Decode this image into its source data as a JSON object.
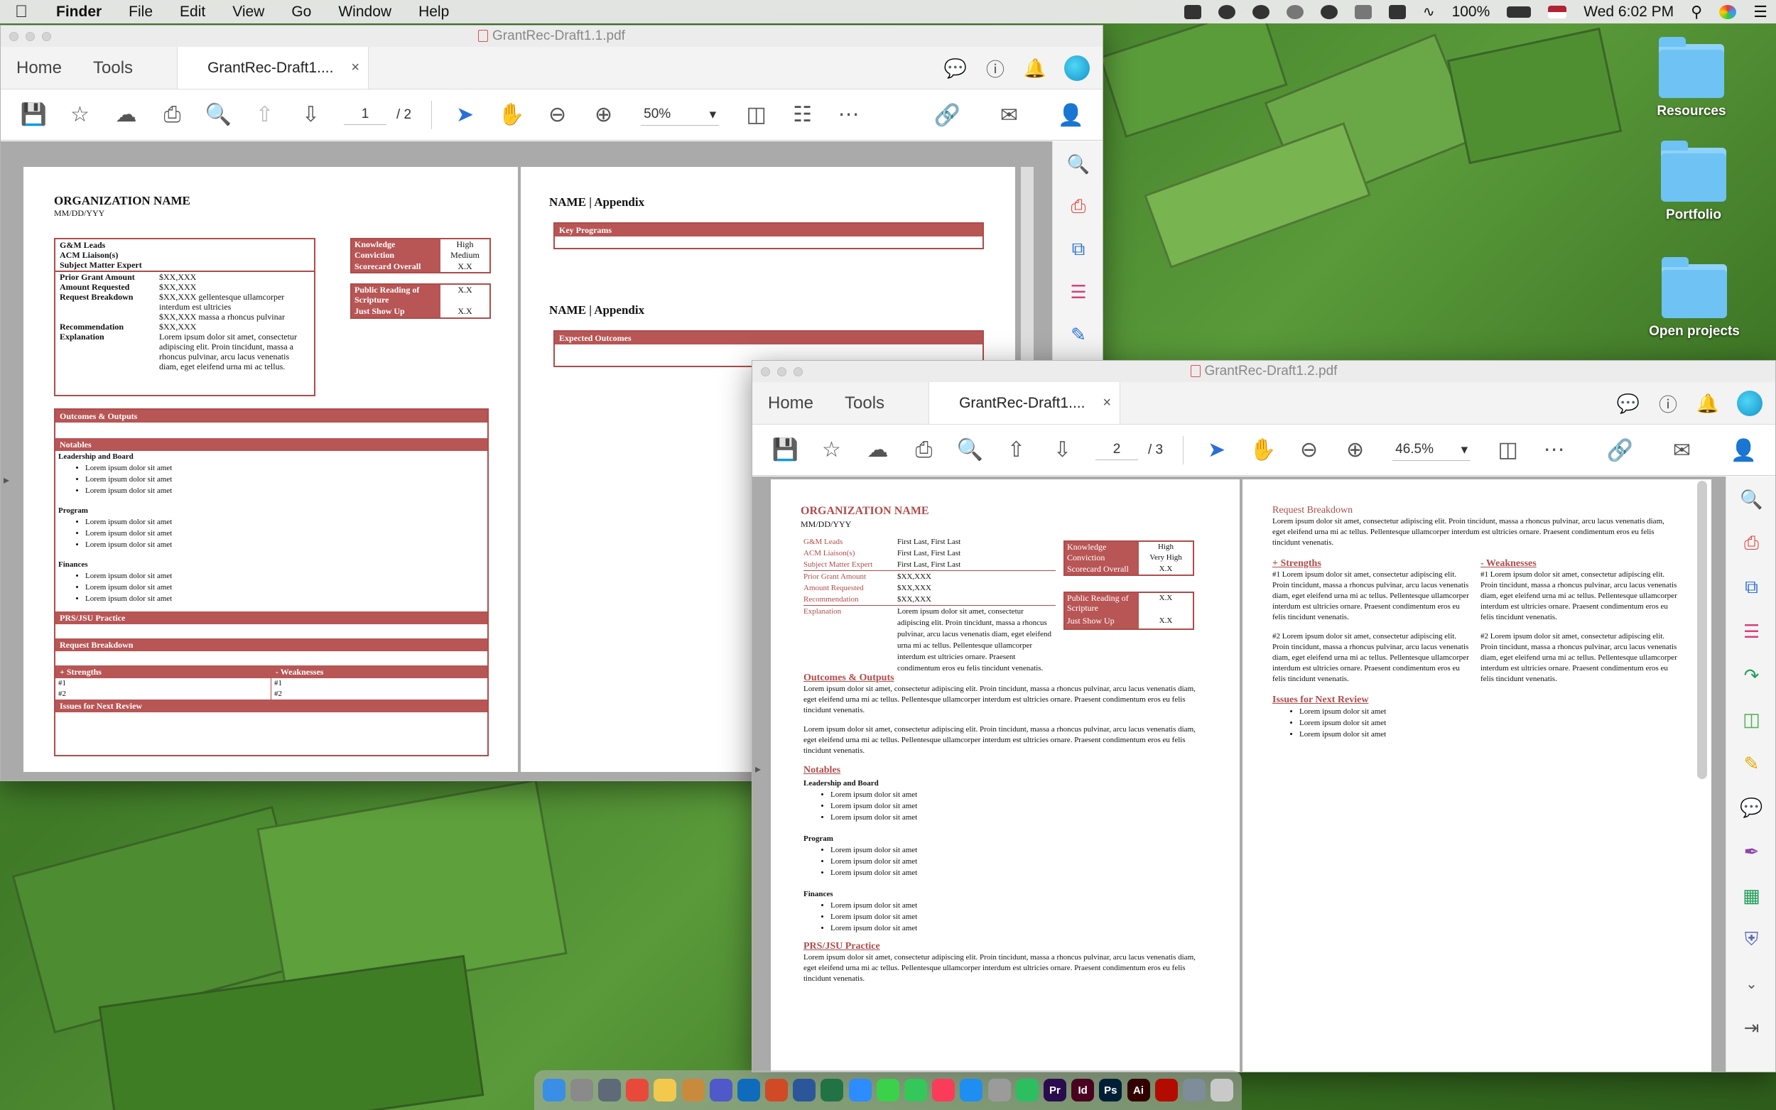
{
  "menubar": {
    "app": "Finder",
    "items": [
      "File",
      "Edit",
      "View",
      "Go",
      "Window",
      "Help"
    ],
    "battery": "100%",
    "clock": "Wed 6:02 PM"
  },
  "desktop": {
    "folders": [
      "Resources",
      "Portfolio",
      "Open projects"
    ]
  },
  "window1": {
    "title": "GrantRec-Draft1.1.pdf",
    "nav_home": "Home",
    "nav_tools": "Tools",
    "tab_label": "GrantRec-Draft1....",
    "tab_close": "×",
    "page_current": "1",
    "page_total": "/  2",
    "zoom": "50%",
    "page1": {
      "org_name": "ORGANIZATION NAME",
      "date": "MM/DD/YYY",
      "leads": [
        "G&M Leads",
        "ACM Liaison(s)",
        "Subject Matter Expert"
      ],
      "fields": [
        {
          "label": "Prior Grant Amount",
          "value": "$XX,XXX"
        },
        {
          "label": "Amount Requested",
          "value": "$XX,XXX"
        },
        {
          "label": "Request Breakdown",
          "value": "$XX,XXX gellentesque ullamcorper interdum est ultricies"
        },
        {
          "label": "",
          "value": "$XX,XXX massa a rhoncus pulvinar"
        },
        {
          "label": "Recommendation",
          "value": "$XX,XXX"
        },
        {
          "label": "Explanation",
          "value": "Lorem ipsum dolor sit amet, consectetur adipiscing elit. Proin tincidunt, massa a rhoncus pulvinar, arcu lacus venenatis diam, eget eleifend urna mi ac tellus."
        }
      ],
      "scorecard": [
        {
          "label": "Knowledge",
          "value": "High"
        },
        {
          "label": "Conviction",
          "value": "Medium"
        },
        {
          "label": "Scorecard Overall",
          "value": "X.X"
        }
      ],
      "reading": [
        {
          "label": "Public Reading of Scripture",
          "value": "X.X"
        },
        {
          "label": "Just Show Up",
          "value": "X.X"
        }
      ],
      "outcomes": "Outcomes & Outputs",
      "notables": "Notables",
      "groups": [
        {
          "title": "Leadership and Board",
          "items": [
            "Lorem ipsum dolor sit amet",
            "Lorem ipsum dolor sit amet",
            "Lorem ipsum dolor sit amet"
          ]
        },
        {
          "title": "Program",
          "items": [
            "Lorem ipsum dolor sit amet",
            "Lorem ipsum dolor sit amet",
            "Lorem ipsum dolor sit amet"
          ]
        },
        {
          "title": "Finances",
          "items": [
            "Lorem ipsum dolor sit amet",
            "Lorem ipsum dolor sit amet",
            "Lorem ipsum dolor sit amet"
          ]
        }
      ],
      "prs": "PRS/JSU Practice",
      "request_breakdown": "Request Breakdown",
      "strengths": "+ Strengths",
      "weaknesses": "- Weaknesses",
      "s1": "#1",
      "s2": "#2",
      "issues": "Issues for Next Review"
    },
    "page2": {
      "appendix1": "NAME | Appendix",
      "key_programs": "Key Programs",
      "appendix2": "NAME | Appendix",
      "expected_outcomes": "Expected Outcomes"
    }
  },
  "window2": {
    "title": "GrantRec-Draft1.2.pdf",
    "nav_home": "Home",
    "nav_tools": "Tools",
    "tab_label": "GrantRec-Draft1....",
    "tab_close": "×",
    "page_current": "2",
    "page_total": "/  3",
    "zoom": "46.5%",
    "left": {
      "org_name": "ORGANIZATION NAME",
      "date": "MM/DD/YYY",
      "fields": [
        {
          "label": "G&M Leads",
          "value": "First Last, First Last"
        },
        {
          "label": "ACM Liaison(s)",
          "value": "First Last, First Last"
        },
        {
          "label": "Subject Matter Expert",
          "value": "First Last, First Last"
        },
        {
          "label": "Prior Grant Amount",
          "value": "$XX,XXX"
        },
        {
          "label": "Amount Requested",
          "value": "$XX,XXX"
        },
        {
          "label": "Recommendation",
          "value": "$XX,XXX"
        },
        {
          "label": "Explanation",
          "value": "Lorem ipsum dolor sit amet, consectetur adipiscing elit. Proin tincidunt, massa a rhoncus pulvinar, arcu lacus venenatis diam, eget eleifend urna mi ac tellus. Pellentesque ullamcorper interdum est ultricies ornare. Praesent condimentum eros eu felis tincidunt venenatis."
        }
      ],
      "scorecard": [
        {
          "label": "Knowledge",
          "value": "High"
        },
        {
          "label": "Conviction",
          "value": "Very High"
        },
        {
          "label": "Scorecard Overall",
          "value": "X.X"
        }
      ],
      "reading": [
        {
          "label": "Public Reading of Scripture",
          "value": "X.X"
        },
        {
          "label": "Just Show Up",
          "value": "X.X"
        }
      ],
      "outcomes_title": "Outcomes & Outputs",
      "outcomes_p1": "Lorem ipsum dolor sit amet, consectetur adipiscing elit. Proin tincidunt, massa a rhoncus pulvinar, arcu lacus venenatis diam, eget eleifend urna mi ac tellus. Pellentesque ullamcorper interdum est ultricies ornare. Praesent condimentum eros eu felis tincidunt venenatis.",
      "outcomes_p2": "Lorem ipsum dolor sit amet, consectetur adipiscing elit. Proin tincidunt, massa a rhoncus pulvinar, arcu lacus venenatis diam, eget eleifend urna mi ac tellus. Pellentesque ullamcorper interdum est ultricies ornare. Praesent condimentum eros eu felis tincidunt venenatis.",
      "notables_title": "Notables",
      "groups": [
        {
          "title": "Leadership and Board",
          "items": [
            "Lorem ipsum dolor sit amet",
            "Lorem ipsum dolor sit amet",
            "Lorem ipsum dolor sit amet"
          ]
        },
        {
          "title": "Program",
          "items": [
            "Lorem ipsum dolor sit amet",
            "Lorem ipsum dolor sit amet",
            "Lorem ipsum dolor sit amet"
          ]
        },
        {
          "title": "Finances",
          "items": [
            "Lorem ipsum dolor sit amet",
            "Lorem ipsum dolor sit amet",
            "Lorem ipsum dolor sit amet"
          ]
        }
      ],
      "prs_title": "PRS/JSU Practice",
      "prs_text": "Lorem ipsum dolor sit amet, consectetur adipiscing elit. Proin tincidunt, massa a rhoncus pulvinar, arcu lacus venenatis diam, eget eleifend urna mi ac tellus. Pellentesque ullamcorper interdum est ultricies ornare. Praesent condimentum eros eu felis tincidunt venenatis."
    },
    "right": {
      "rb_title": "Request Breakdown",
      "rb_text": "Lorem ipsum dolor sit amet, consectetur adipiscing elit. Proin tincidunt, massa a rhoncus pulvinar, arcu lacus venenatis diam, eget eleifend urna mi ac tellus. Pellentesque ullamcorper interdum est ultricies ornare. Praesent condimentum eros eu felis tincidunt venenatis.",
      "strengths_title": "+ Strengths",
      "weaknesses_title": "- Weaknesses",
      "s1": "#1  Lorem ipsum dolor sit amet, consectetur adipiscing elit. Proin tincidunt, massa a rhoncus pulvinar, arcu lacus venenatis diam, eget eleifend urna mi ac tellus. Pellentesque ullamcorper interdum est ultricies ornare. Praesent condimentum eros eu felis tincidunt venenatis.",
      "s2": "#2  Lorem ipsum dolor sit amet, consectetur adipiscing elit. Proin tincidunt, massa a rhoncus pulvinar, arcu lacus venenatis diam, eget eleifend urna mi ac tellus. Pellentesque ullamcorper interdum est ultricies ornare. Praesent condimentum eros eu felis tincidunt venenatis.",
      "w1": "#1  Lorem ipsum dolor sit amet, consectetur adipiscing elit. Proin tincidunt, massa a rhoncus pulvinar, arcu lacus venenatis diam, eget eleifend urna mi ac tellus. Pellentesque ullamcorper interdum est ultricies ornare. Praesent condimentum eros eu felis tincidunt venenatis.",
      "w2": "#2  Lorem ipsum dolor sit amet, consectetur adipiscing elit. Proin tincidunt, massa a rhoncus pulvinar, arcu lacus venenatis diam, eget eleifend urna mi ac tellus. Pellentesque ullamcorper interdum est ultricies ornare. Praesent condimentum eros eu felis tincidunt venenatis.",
      "issues_title": "Issues for Next Review",
      "issues": [
        "Lorem ipsum dolor sit amet",
        "Lorem ipsum dolor sit amet",
        "Lorem ipsum dolor sit amet"
      ]
    }
  },
  "dock": {
    "apps": [
      "finder-icon",
      "system-preferences-icon",
      "launchpad-icon",
      "chrome-icon",
      "notes-icon",
      "books-icon",
      "teams-icon",
      "outlook-icon",
      "powerpoint-icon",
      "word-icon",
      "excel-icon",
      "zoom-icon",
      "messages-icon",
      "facetime-icon",
      "music-icon",
      "app-store-icon",
      "script-editor-icon",
      "evernote-icon",
      "premiere-icon",
      "indesign-icon",
      "photoshop-icon",
      "illustrator-icon",
      "acrobat-icon",
      "preview-icon",
      "trash-icon"
    ],
    "colors": [
      "#3a8ee6",
      "#8a8a8a",
      "#5e6a78",
      "#e9493a",
      "#f2c94c",
      "#c98a3d",
      "#5059c9",
      "#0f6cbd",
      "#d04a25",
      "#2b579a",
      "#217346",
      "#2d8cff",
      "#3bd14a",
      "#34c759",
      "#fa3c5a",
      "#1f8ef1",
      "#9b9b9b",
      "#2dbe60",
      "#2a0c4e",
      "#49021f",
      "#001e36",
      "#330000",
      "#b30b00",
      "#7f8c9a",
      "#c9c9c9"
    ],
    "labels": {
      "premiere": "Pr",
      "indesign": "Id",
      "photoshop": "Ps",
      "illustrator": "Ai"
    }
  }
}
